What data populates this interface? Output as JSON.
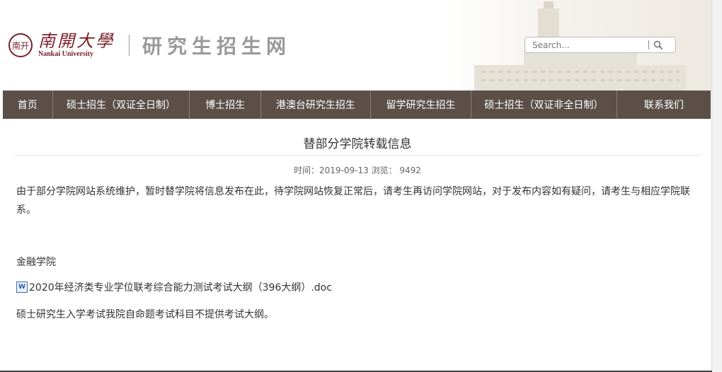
{
  "header": {
    "logo_seal": "南开",
    "logo_cn": "南開大學",
    "logo_en": "Nankai University",
    "site_title": "研究生招生网",
    "search_placeholder": "Search...",
    "search_icon": "magnifier"
  },
  "nav": {
    "items": [
      {
        "label": "首页"
      },
      {
        "label": "硕士招生（双证全日制）"
      },
      {
        "label": "博士招生"
      },
      {
        "label": "港澳台研究生招生"
      },
      {
        "label": "留学研究生招生"
      },
      {
        "label": "硕士招生（双证非全日制）"
      },
      {
        "label": "联系我们"
      }
    ]
  },
  "article": {
    "title": "替部分学院转载信息",
    "meta": "时间：2019-09-13   浏览：  9492",
    "intro": "由于部分学院网站系统维护，暂时替学院将信息发布在此，待学院网站恢复正常后，请考生再访问学院网站，对于发布内容如有疑问，请考生与相应学院联系。",
    "college": "金融学院",
    "attachment_icon": "word-doc-icon",
    "attachment": "2020年经济类专业学位联考综合能力测试考试大纲（396大纲）.doc",
    "notice": "硕士研究生入学考试我院自命题考试科目不提供考试大纲。"
  },
  "colors": {
    "nav_bg": "#5b4f48",
    "brand": "#7a1f2b",
    "site_title": "#999999"
  }
}
